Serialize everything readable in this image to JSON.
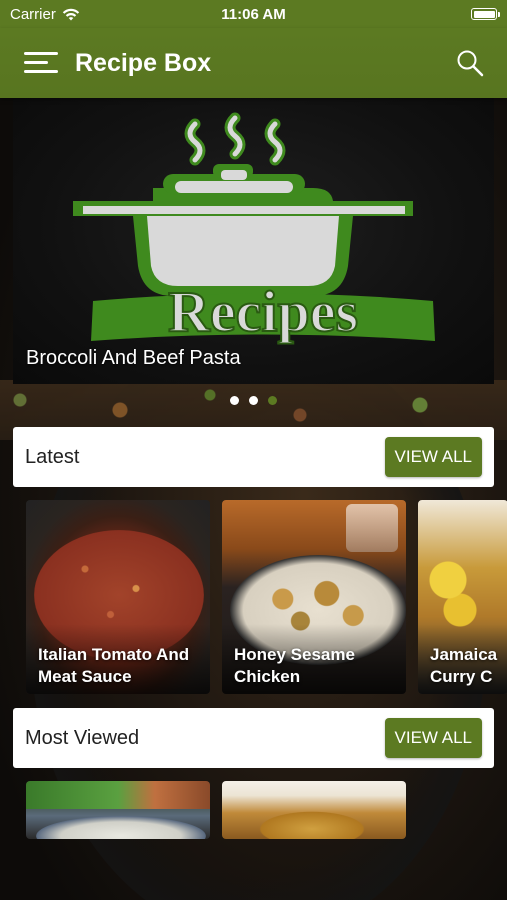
{
  "status_bar": {
    "carrier": "Carrier",
    "time": "11:06 AM"
  },
  "app_bar": {
    "title": "Recipe Box"
  },
  "hero": {
    "logo_text": "Recipes",
    "caption": "Broccoli And Beef Pasta",
    "slide_count": 3,
    "active_slide": 3
  },
  "latest": {
    "title": "Latest",
    "view_all": "VIEW ALL",
    "items": [
      {
        "title": "Italian Tomato And Meat Sauce"
      },
      {
        "title": "Honey Sesame Chicken"
      },
      {
        "title": "Jamaica Curry C"
      }
    ]
  },
  "most_viewed": {
    "title": "Most Viewed",
    "view_all": "VIEW ALL"
  },
  "colors": {
    "primary": "#5c7a22",
    "logo_green": "#3f8a1e"
  }
}
